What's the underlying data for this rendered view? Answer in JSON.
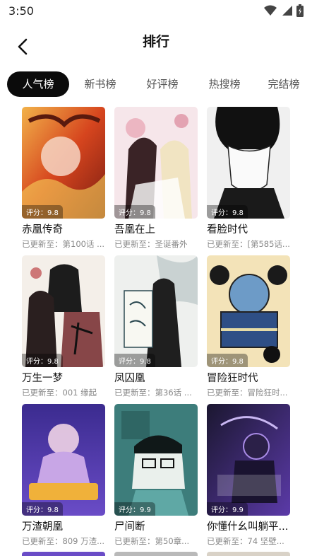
{
  "status_bar": {
    "time": "3:50"
  },
  "header": {
    "title": "排行"
  },
  "tabs": [
    "人气榜",
    "新书榜",
    "好评榜",
    "热搜榜",
    "完结榜"
  ],
  "active_tab": 0,
  "comics": [
    {
      "title": "赤凰传奇",
      "score": "评分：9.8",
      "update": "已更新至：第100话 ..."
    },
    {
      "title": "吾凰在上",
      "score": "评分：9.8",
      "update": "已更新至：圣诞番外"
    },
    {
      "title": "看脸时代",
      "score": "评分：9.8",
      "update": "已更新至：[第585话..."
    },
    {
      "title": "万生一梦",
      "score": "评分：9.8",
      "update": "已更新至：001 缘起"
    },
    {
      "title": "凤囚凰",
      "score": "评分：9.8",
      "update": "已更新至：第36话 ..."
    },
    {
      "title": "冒险狂时代",
      "score": "评分：9.8",
      "update": "已更新至：冒险狂时..."
    },
    {
      "title": "万渣朝凰",
      "score": "评分：9.8",
      "update": "已更新至：809 万渣..."
    },
    {
      "title": "尸间断",
      "score": "评分：9.9",
      "update": "已更新至：第50章..."
    },
    {
      "title": "你懂什幺叫躺平...",
      "score": "评分：9.9",
      "update": "已更新至：74 坚壁..."
    }
  ],
  "colors": {
    "accent": "#0b0b0b",
    "muted_text": "#888888",
    "tab_text": "#555555"
  }
}
